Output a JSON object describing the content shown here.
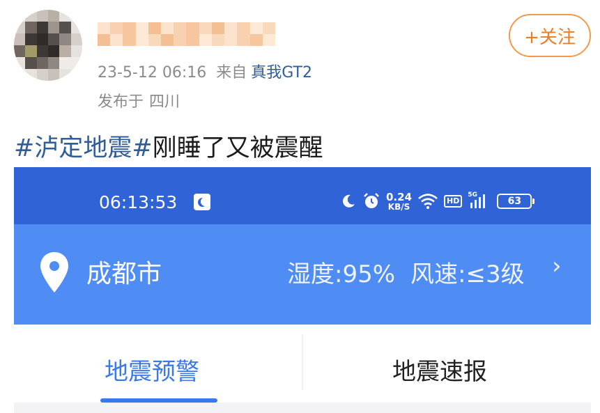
{
  "post": {
    "date_time": "23-5-12 06:16",
    "source_prefix": "来自",
    "device": "真我GT2",
    "location_prefix": "发布于",
    "location": "四川",
    "follow_label": "+关注",
    "hashtag": "#泸定地震#",
    "text": "刚睡了又被震醒"
  },
  "screenshot": {
    "status_bar": {
      "time": "06:13:53",
      "net_speed_value": "0.24",
      "net_speed_unit": "KB/S",
      "hd_label": "HD",
      "network_label": "5G",
      "battery": "63",
      "bg_color": "#2f63d6"
    },
    "city_bar": {
      "city": "成都市",
      "humidity": "湿度:95%",
      "wind": "风速:≤3级",
      "chevron": "›",
      "bg_color": "#4f8cf4"
    },
    "tabs": [
      {
        "label": "地震预警",
        "active": true
      },
      {
        "label": "地震速报",
        "active": false
      }
    ],
    "accent_color": "#3a78f0"
  },
  "icons": [
    "avatar",
    "moon-icon",
    "alarm-icon",
    "wifi-icon",
    "signal-icon",
    "battery-icon",
    "location-pin-icon",
    "chevron-right-icon"
  ]
}
